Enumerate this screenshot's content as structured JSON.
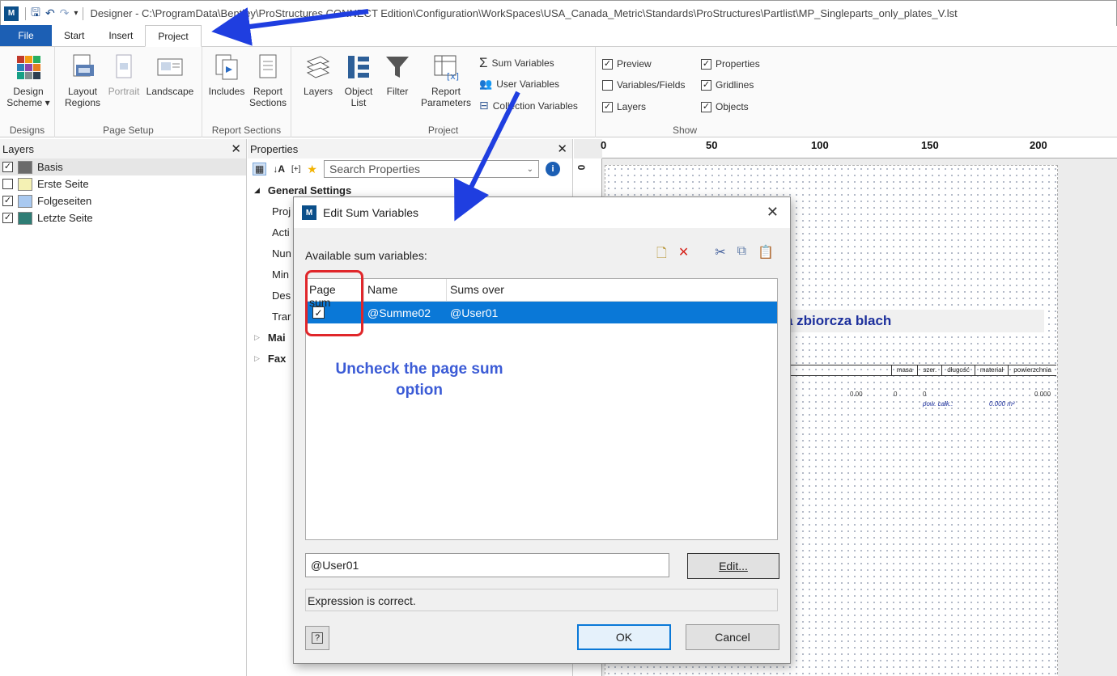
{
  "titlebar": {
    "title": "Designer - C:\\ProgramData\\Bentley\\ProStructures CONNECT Edition\\Configuration\\WorkSpaces\\USA_Canada_Metric\\Standards\\ProStructures\\Partlist\\MP_Singleparts_only_plates_V.lst"
  },
  "tabs": [
    "File",
    "Start",
    "Insert",
    "Project"
  ],
  "ribbon": {
    "designs": {
      "label": "Designs",
      "design_scheme": "Design\nScheme ▾"
    },
    "page_setup": {
      "label": "Page Setup",
      "layout_regions": "Layout\nRegions",
      "portrait": "Portrait",
      "landscape": "Landscape"
    },
    "report_sections": {
      "label": "Report Sections",
      "includes": "Includes",
      "report_sections": "Report\nSections"
    },
    "project": {
      "label": "Project",
      "layers": "Layers",
      "object_list": "Object\nList",
      "filter": "Filter",
      "report_parameters": "Report\nParameters",
      "sum_variables": "Sum Variables",
      "user_variables": "User Variables",
      "collection_variables": "Collection Variables"
    },
    "show": {
      "label": "Show",
      "items": [
        {
          "label": "Preview",
          "checked": "✓"
        },
        {
          "label": "Variables/Fields",
          "checked": ""
        },
        {
          "label": "Layers",
          "checked": "✓"
        },
        {
          "label": "Properties",
          "checked": "✓"
        },
        {
          "label": "Gridlines",
          "checked": "✓"
        },
        {
          "label": "Objects",
          "checked": "✓"
        }
      ]
    }
  },
  "layers_panel": {
    "title": "Layers",
    "items": [
      {
        "label": "Basis",
        "checked": "✓",
        "color": "#6b6b6b"
      },
      {
        "label": "Erste Seite",
        "checked": "",
        "color": "#f4f1b4"
      },
      {
        "label": "Folgeseiten",
        "checked": "✓",
        "color": "#a9c9f0"
      },
      {
        "label": "Letzte Seite",
        "checked": "✓",
        "color": "#2f7d75"
      }
    ]
  },
  "properties_panel": {
    "title": "Properties",
    "search_placeholder": "Search Properties",
    "rows": [
      {
        "label": "General Settings",
        "kind": "cat"
      },
      {
        "label": "Proj",
        "kind": "item"
      },
      {
        "label": "Acti",
        "kind": "item"
      },
      {
        "label": "Nun",
        "kind": "item"
      },
      {
        "label": "Min",
        "kind": "item"
      },
      {
        "label": "Des",
        "kind": "item"
      },
      {
        "label": "Trar",
        "kind": "item"
      },
      {
        "label": "Mai",
        "kind": "cat"
      },
      {
        "label": "Fax",
        "kind": "cat"
      }
    ]
  },
  "canvas": {
    "ruler": [
      "0",
      "50",
      "100",
      "150",
      "200"
    ],
    "report_title": "a zbiorcza blach",
    "columns": [
      "masa",
      "szer.",
      "długość",
      "materiał",
      "powierzchnia"
    ],
    "values": [
      "0.00",
      "0",
      "0",
      "0.000"
    ],
    "total_label": "pow. całk.:",
    "total_value": "0.000 m²"
  },
  "dialog": {
    "title": "Edit Sum Variables",
    "available_label": "Available sum variables:",
    "columns": {
      "page_sum": "Page sum",
      "name": "Name",
      "sums_over": "Sums over"
    },
    "row": {
      "checked": "✓",
      "name": "@Summe02",
      "sums_over": "@User01"
    },
    "hint": "Uncheck the page sum option",
    "expression": "@User01",
    "edit_label": "Edit...",
    "status": "Expression is correct.",
    "ok_label": "OK",
    "cancel_label": "Cancel"
  },
  "colors": {
    "accent": "#1c5fb4",
    "selection": "#0a78d7",
    "callout": "#e0262a",
    "arrow": "#1f3ee0",
    "hint": "#3b5bd6"
  }
}
